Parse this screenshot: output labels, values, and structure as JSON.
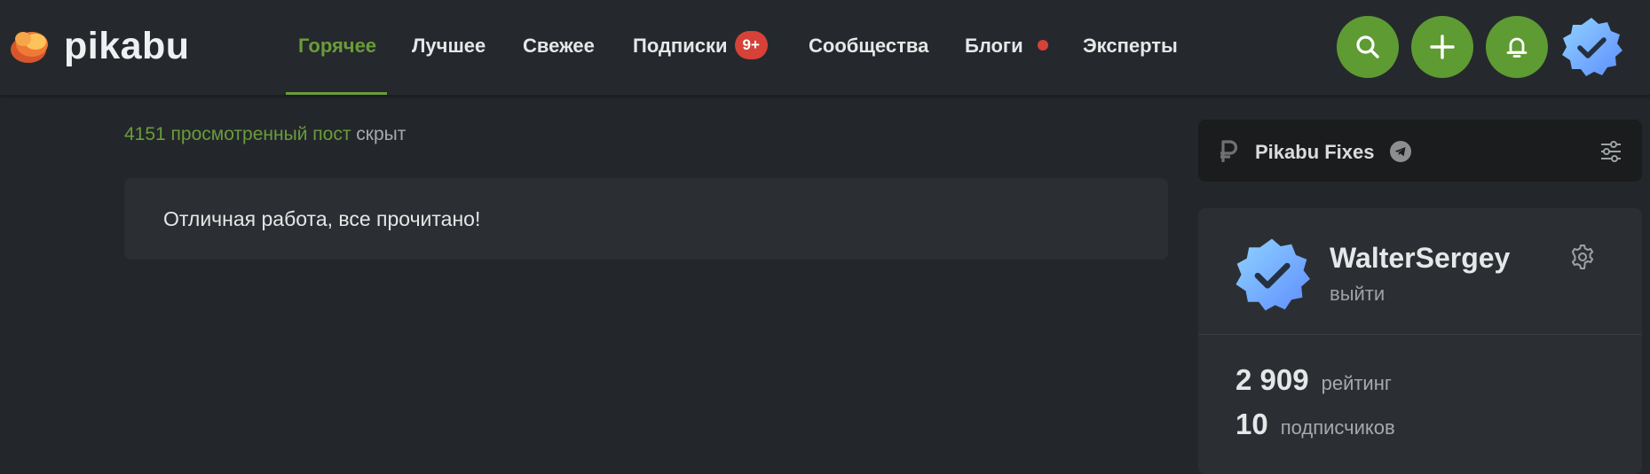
{
  "header": {
    "logo_text": "pikabu",
    "nav": [
      {
        "label": "Горячее",
        "active": true
      },
      {
        "label": "Лучшее"
      },
      {
        "label": "Свежее"
      },
      {
        "label": "Подписки",
        "badge": "9+"
      },
      {
        "label": "Сообщества"
      },
      {
        "label": "Блоги",
        "dot": true
      },
      {
        "label": "Эксперты"
      }
    ],
    "icons": [
      "search-icon",
      "plus-icon",
      "bell-icon",
      "avatar"
    ],
    "accent_color": "#5e9b33",
    "badge_color": "#d64238"
  },
  "main": {
    "hidden_count": "4151 просмотренный пост",
    "hidden_suffix": " скрыт",
    "done_message": "Отличная работа, все прочитано!"
  },
  "sidebar": {
    "fixes": {
      "title": "Pikabu Fixes",
      "icons": [
        "ruble-logo-icon",
        "telegram-icon",
        "sliders-icon"
      ]
    },
    "profile": {
      "username": "WalterSergey",
      "logout": "выйти",
      "rating_value": "2 909",
      "rating_label": "рейтинг",
      "followers_value": "10",
      "followers_label": "подписчиков"
    }
  }
}
